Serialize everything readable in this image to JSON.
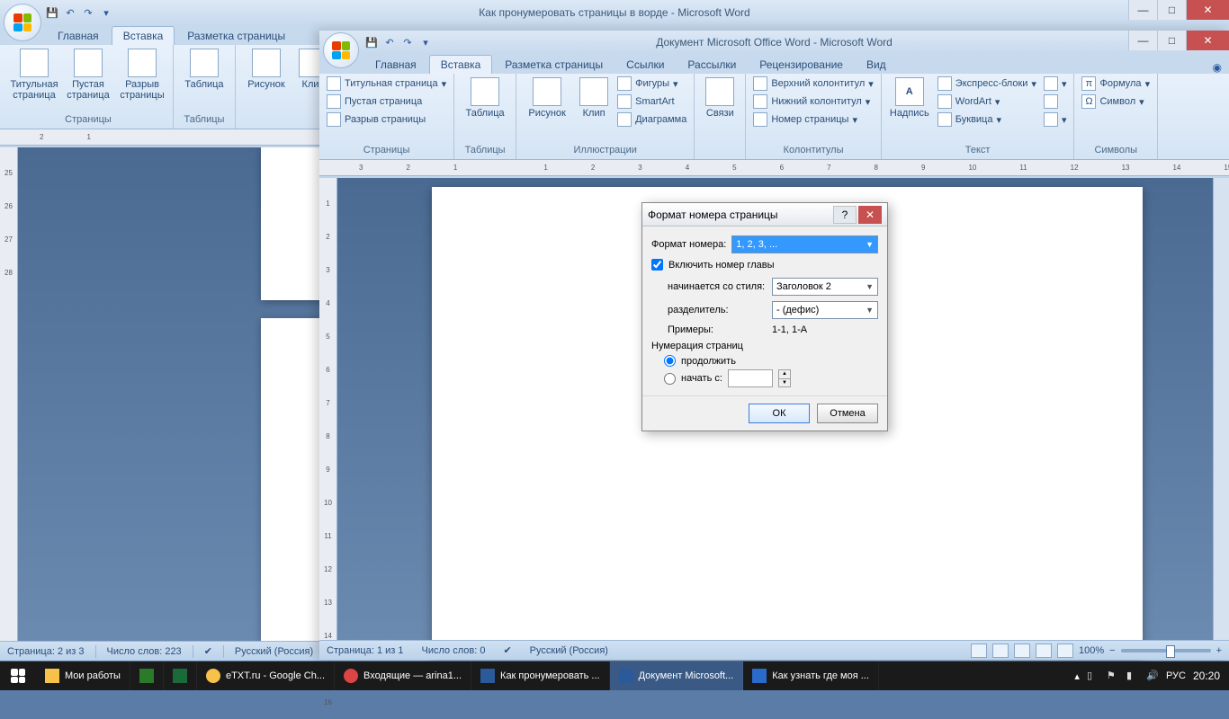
{
  "win1": {
    "title": "Как пронумеровать страницы в ворде - Microsoft Word",
    "tabs": {
      "home": "Главная",
      "insert": "Вставка",
      "layout": "Разметка страницы"
    },
    "ribbon": {
      "pages": {
        "cover": "Титульная страница",
        "blank": "Пустая страница",
        "break": "Разрыв страницы",
        "group": "Страницы"
      },
      "tables": {
        "table": "Таблица",
        "group": "Таблицы"
      },
      "illus": {
        "picture": "Рисунок",
        "clip": "Клип"
      }
    },
    "status": {
      "page": "Страница: 2 из 3",
      "words": "Число слов: 223",
      "lang": "Русский (Россия)"
    }
  },
  "win2": {
    "title": "Документ Microsoft Office Word - Microsoft Word",
    "tabs": {
      "home": "Главная",
      "insert": "Вставка",
      "layout": "Разметка страницы",
      "refs": "Ссылки",
      "mail": "Рассылки",
      "review": "Рецензирование",
      "view": "Вид"
    },
    "ribbon": {
      "pages": {
        "cover": "Титульная страница",
        "blank": "Пустая страница",
        "break": "Разрыв страницы",
        "group": "Страницы"
      },
      "tables": {
        "table": "Таблица",
        "group": "Таблицы"
      },
      "illus": {
        "picture": "Рисунок",
        "clip": "Клип",
        "shapes": "Фигуры",
        "smartart": "SmartArt",
        "chart": "Диаграмма",
        "group": "Иллюстрации"
      },
      "links": {
        "links": "Связи",
        "group": ""
      },
      "hf": {
        "header": "Верхний колонтитул",
        "footer": "Нижний колонтитул",
        "pagenum": "Номер страницы",
        "group": "Колонтитулы"
      },
      "text": {
        "textbox": "Надпись",
        "quickparts": "Экспресс-блоки",
        "wordart": "WordArt",
        "dropcap": "Буквица",
        "group": "Текст"
      },
      "symbols": {
        "equation": "Формула",
        "symbol": "Символ",
        "group": "Символы"
      }
    },
    "status": {
      "page": "Страница: 1 из 1",
      "words": "Число слов: 0",
      "lang": "Русский (Россия)",
      "zoom": "100%"
    }
  },
  "dialog": {
    "title": "Формат номера страницы",
    "format_label": "Формат номера:",
    "format_value": "1, 2, 3, ...",
    "include_chapter": "Включить номер главы",
    "starts_style_label": "начинается со стиля:",
    "starts_style_value": "Заголовок 2",
    "separator_label": "разделитель:",
    "separator_value": "-   (дефис)",
    "examples_label": "Примеры:",
    "examples_value": "1-1, 1-A",
    "numbering_label": "Нумерация страниц",
    "radio_continue": "продолжить",
    "radio_startat": "начать с:",
    "ok": "ОК",
    "cancel": "Отмена"
  },
  "taskbar": {
    "items": [
      "Мои работы",
      "",
      "",
      "eTXT.ru - Google Ch...",
      "Входящие — arina1...",
      "Как пронумеровать ...",
      "Документ Microsoft...",
      "Как узнать где моя ..."
    ],
    "lang": "РУС",
    "clock": "20:20"
  }
}
